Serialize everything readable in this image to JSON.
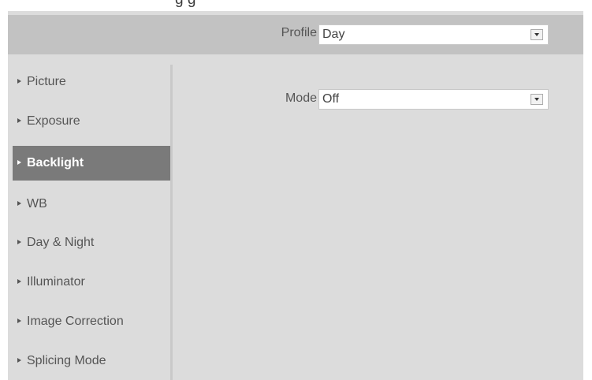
{
  "header_fragment": "g                  g",
  "profile": {
    "label": "Profile",
    "value": "Day"
  },
  "sidebar": {
    "items": [
      {
        "label": "Picture",
        "active": false
      },
      {
        "label": "Exposure",
        "active": false
      },
      {
        "label": "Backlight",
        "active": true
      },
      {
        "label": "WB",
        "active": false
      },
      {
        "label": "Day & Night",
        "active": false
      },
      {
        "label": "Illuminator",
        "active": false
      },
      {
        "label": "Image Correction",
        "active": false
      },
      {
        "label": "Splicing Mode",
        "active": false
      }
    ]
  },
  "backlight": {
    "mode_label": "Mode",
    "mode_value": "Off"
  },
  "colors": {
    "panel_bg": "#dcdcdc",
    "profile_bar_bg": "#c2c2c2",
    "active_item_bg": "#7a7a7a"
  },
  "icons": {
    "sidebar_marker": "caret-right-icon",
    "dropdown": "chevron-down-icon"
  }
}
